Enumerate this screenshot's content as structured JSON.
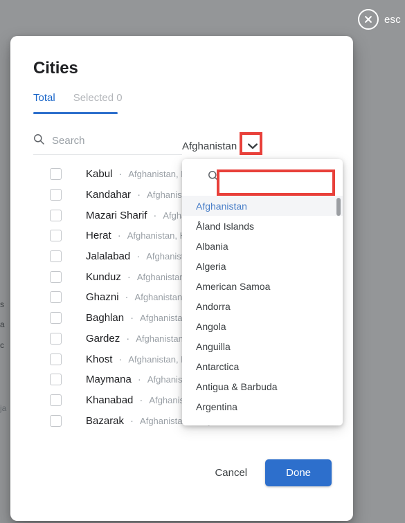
{
  "background": {
    "top_text": "",
    "left_fragments": [
      "s",
      "a",
      "c",
      "ja"
    ]
  },
  "esc": {
    "label": "esc",
    "icon": "close-circle-icon"
  },
  "modal": {
    "title": "Cities",
    "tabs": [
      {
        "label": "Total",
        "active": true
      },
      {
        "label": "Selected 0",
        "active": false
      }
    ],
    "search": {
      "icon": "search-icon",
      "placeholder": "Search",
      "value": ""
    },
    "country_selector": {
      "value": "Afghanistan",
      "chevron_icon": "chevron-down-icon"
    },
    "cities": [
      {
        "name": "Kabul",
        "separator": "·",
        "sub": "Afghanistan, Kabul"
      },
      {
        "name": "Kandahar",
        "separator": "·",
        "sub": "Afghanistan, Kandahar"
      },
      {
        "name": "Mazari Sharif",
        "separator": "·",
        "sub": "Afghanistan, Balkh"
      },
      {
        "name": "Herat",
        "separator": "·",
        "sub": "Afghanistan, Herat"
      },
      {
        "name": "Jalalabad",
        "separator": "·",
        "sub": "Afghanistan, Nangarhar"
      },
      {
        "name": "Kunduz",
        "separator": "·",
        "sub": "Afghanistan, Kunduz"
      },
      {
        "name": "Ghazni",
        "separator": "·",
        "sub": "Afghanistan, Ghazni"
      },
      {
        "name": "Baghlan",
        "separator": "·",
        "sub": "Afghanistan, Baghlan"
      },
      {
        "name": "Gardez",
        "separator": "·",
        "sub": "Afghanistan, Paktia"
      },
      {
        "name": "Khost",
        "separator": "·",
        "sub": "Afghanistan, Khost"
      },
      {
        "name": "Maymana",
        "separator": "·",
        "sub": "Afghanistan, Faryab"
      },
      {
        "name": "Khanabad",
        "separator": "·",
        "sub": "Afghanistan, Kunduz"
      },
      {
        "name": "Bazarak",
        "separator": "·",
        "sub": "Afghanistan, Panjshir"
      }
    ],
    "dropdown": {
      "search": {
        "icon": "search-icon",
        "placeholder": "",
        "value": ""
      },
      "options": [
        {
          "label": "Afghanistan",
          "selected": true
        },
        {
          "label": "Åland Islands",
          "selected": false
        },
        {
          "label": "Albania",
          "selected": false
        },
        {
          "label": "Algeria",
          "selected": false
        },
        {
          "label": "American Samoa",
          "selected": false
        },
        {
          "label": "Andorra",
          "selected": false
        },
        {
          "label": "Angola",
          "selected": false
        },
        {
          "label": "Anguilla",
          "selected": false
        },
        {
          "label": "Antarctica",
          "selected": false
        },
        {
          "label": "Antigua & Barbuda",
          "selected": false
        },
        {
          "label": "Argentina",
          "selected": false
        }
      ]
    },
    "footer": {
      "cancel_label": "Cancel",
      "done_label": "Done"
    }
  },
  "colors": {
    "accent_blue": "#2d6fcc",
    "tab_active": "#1a66c9",
    "annotation_red": "#e8403a",
    "muted_gray": "#9aa0a6",
    "scrim": "rgba(60,64,67,0.55)"
  }
}
